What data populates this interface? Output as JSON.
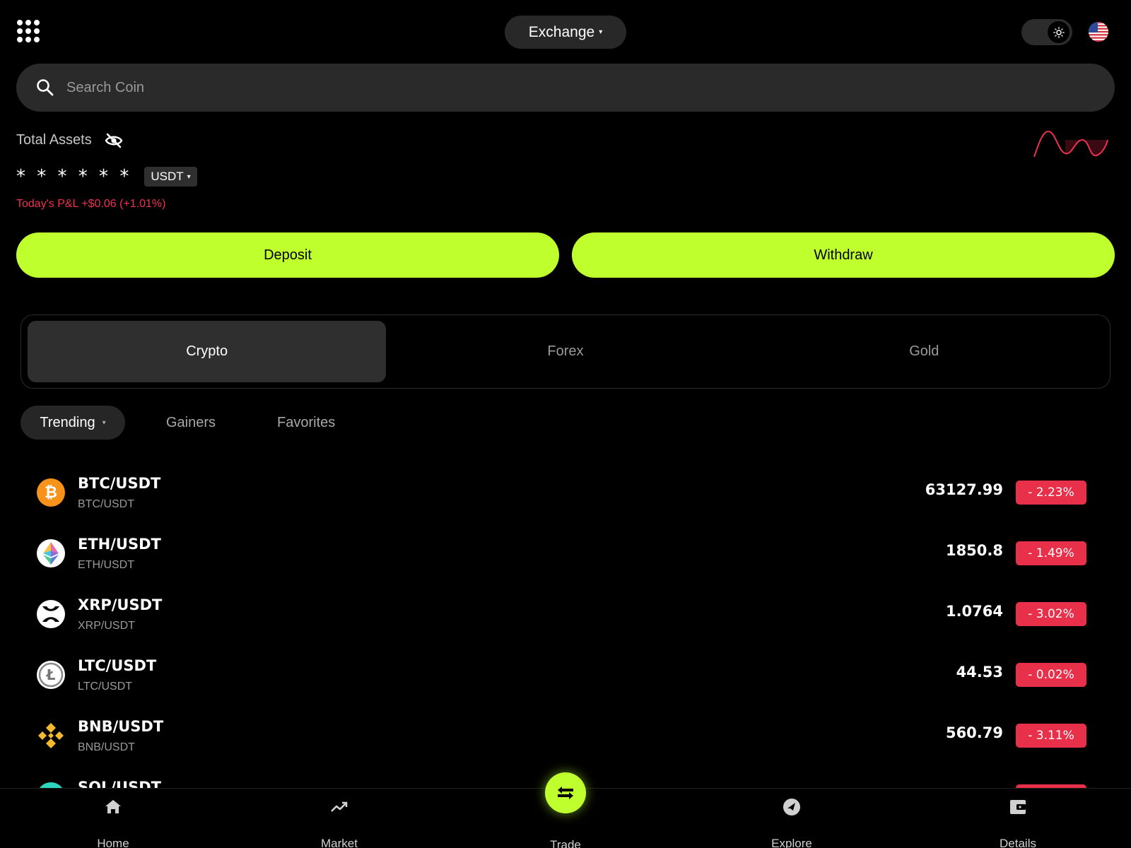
{
  "header": {
    "exchange_label": "Exchange"
  },
  "search": {
    "placeholder": "Search Coin"
  },
  "assets": {
    "label": "Total Assets",
    "masked_value": "* * * * * *",
    "currency": "USDT",
    "pnl": "Today's P&L +$0.06 (+1.01%)"
  },
  "actions": {
    "deposit": "Deposit",
    "withdraw": "Withdraw"
  },
  "market_tabs": [
    "Crypto",
    "Forex",
    "Gold"
  ],
  "sub_tabs": {
    "trending": "Trending",
    "gainers": "Gainers",
    "favorites": "Favorites"
  },
  "coins": [
    {
      "name": "BTC/USDT",
      "sub": "BTC/USDT",
      "price": "63127.99",
      "change": "- 2.23%"
    },
    {
      "name": "ETH/USDT",
      "sub": "ETH/USDT",
      "price": "1850.8",
      "change": "- 1.49%"
    },
    {
      "name": "XRP/USDT",
      "sub": "XRP/USDT",
      "price": "1.0764",
      "change": "- 3.02%"
    },
    {
      "name": "LTC/USDT",
      "sub": "LTC/USDT",
      "price": "44.53",
      "change": "- 0.02%"
    },
    {
      "name": "BNB/USDT",
      "sub": "BNB/USDT",
      "price": "560.79",
      "change": "- 3.11%"
    },
    {
      "name": "SOL/USDT",
      "sub": "",
      "price": "",
      "change": ""
    }
  ],
  "nav": {
    "home": "Home",
    "market": "Market",
    "trade": "Trade",
    "explore": "Explore",
    "details": "Details"
  },
  "colors": {
    "accent": "#c0ff2e",
    "negative": "#e8304b",
    "pnl": "#f0304f"
  }
}
